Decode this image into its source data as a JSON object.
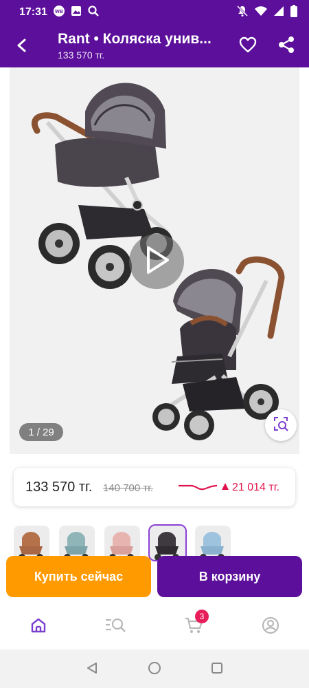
{
  "status_bar": {
    "time": "17:31",
    "icons": [
      "wb-icon",
      "image-icon",
      "search-icon",
      "mute-icon",
      "wifi-icon",
      "signal-icon",
      "battery-icon"
    ]
  },
  "app_bar": {
    "title": "Rant • Коляска унив...",
    "subtitle": "133 570 тг.",
    "icons": [
      "back-arrow-icon",
      "heart-icon",
      "share-icon"
    ]
  },
  "gallery": {
    "counter": "1 / 29",
    "icons": [
      "play-icon",
      "visual-search-icon"
    ]
  },
  "price": {
    "current": "133 570 тг.",
    "old": "140 700 тг.",
    "diff": "21 014 тг.",
    "diff_icon": "triangle-up-icon",
    "accent_color": "#e0144c"
  },
  "variants": {
    "count": 5,
    "selected_index": 3,
    "colors": [
      "#b5714a",
      "#8fb5b8",
      "#e8b4b0",
      "#3f3a40",
      "#9ec3de"
    ]
  },
  "actions": {
    "buy_now": "Купить сейчас",
    "add_to_cart": "В корзину",
    "buy_color": "#ff9b00",
    "cart_color": "#5b0f9a"
  },
  "bottom_nav": {
    "items": [
      "home-icon",
      "catalog-search-icon",
      "cart-icon",
      "profile-icon"
    ],
    "cart_badge": "3",
    "active": "home"
  },
  "system_nav": [
    "back-triangle-icon",
    "home-circle-icon",
    "recents-square-icon"
  ],
  "colors": {
    "brand": "#5b0f9a",
    "orange": "#ff9b00"
  }
}
